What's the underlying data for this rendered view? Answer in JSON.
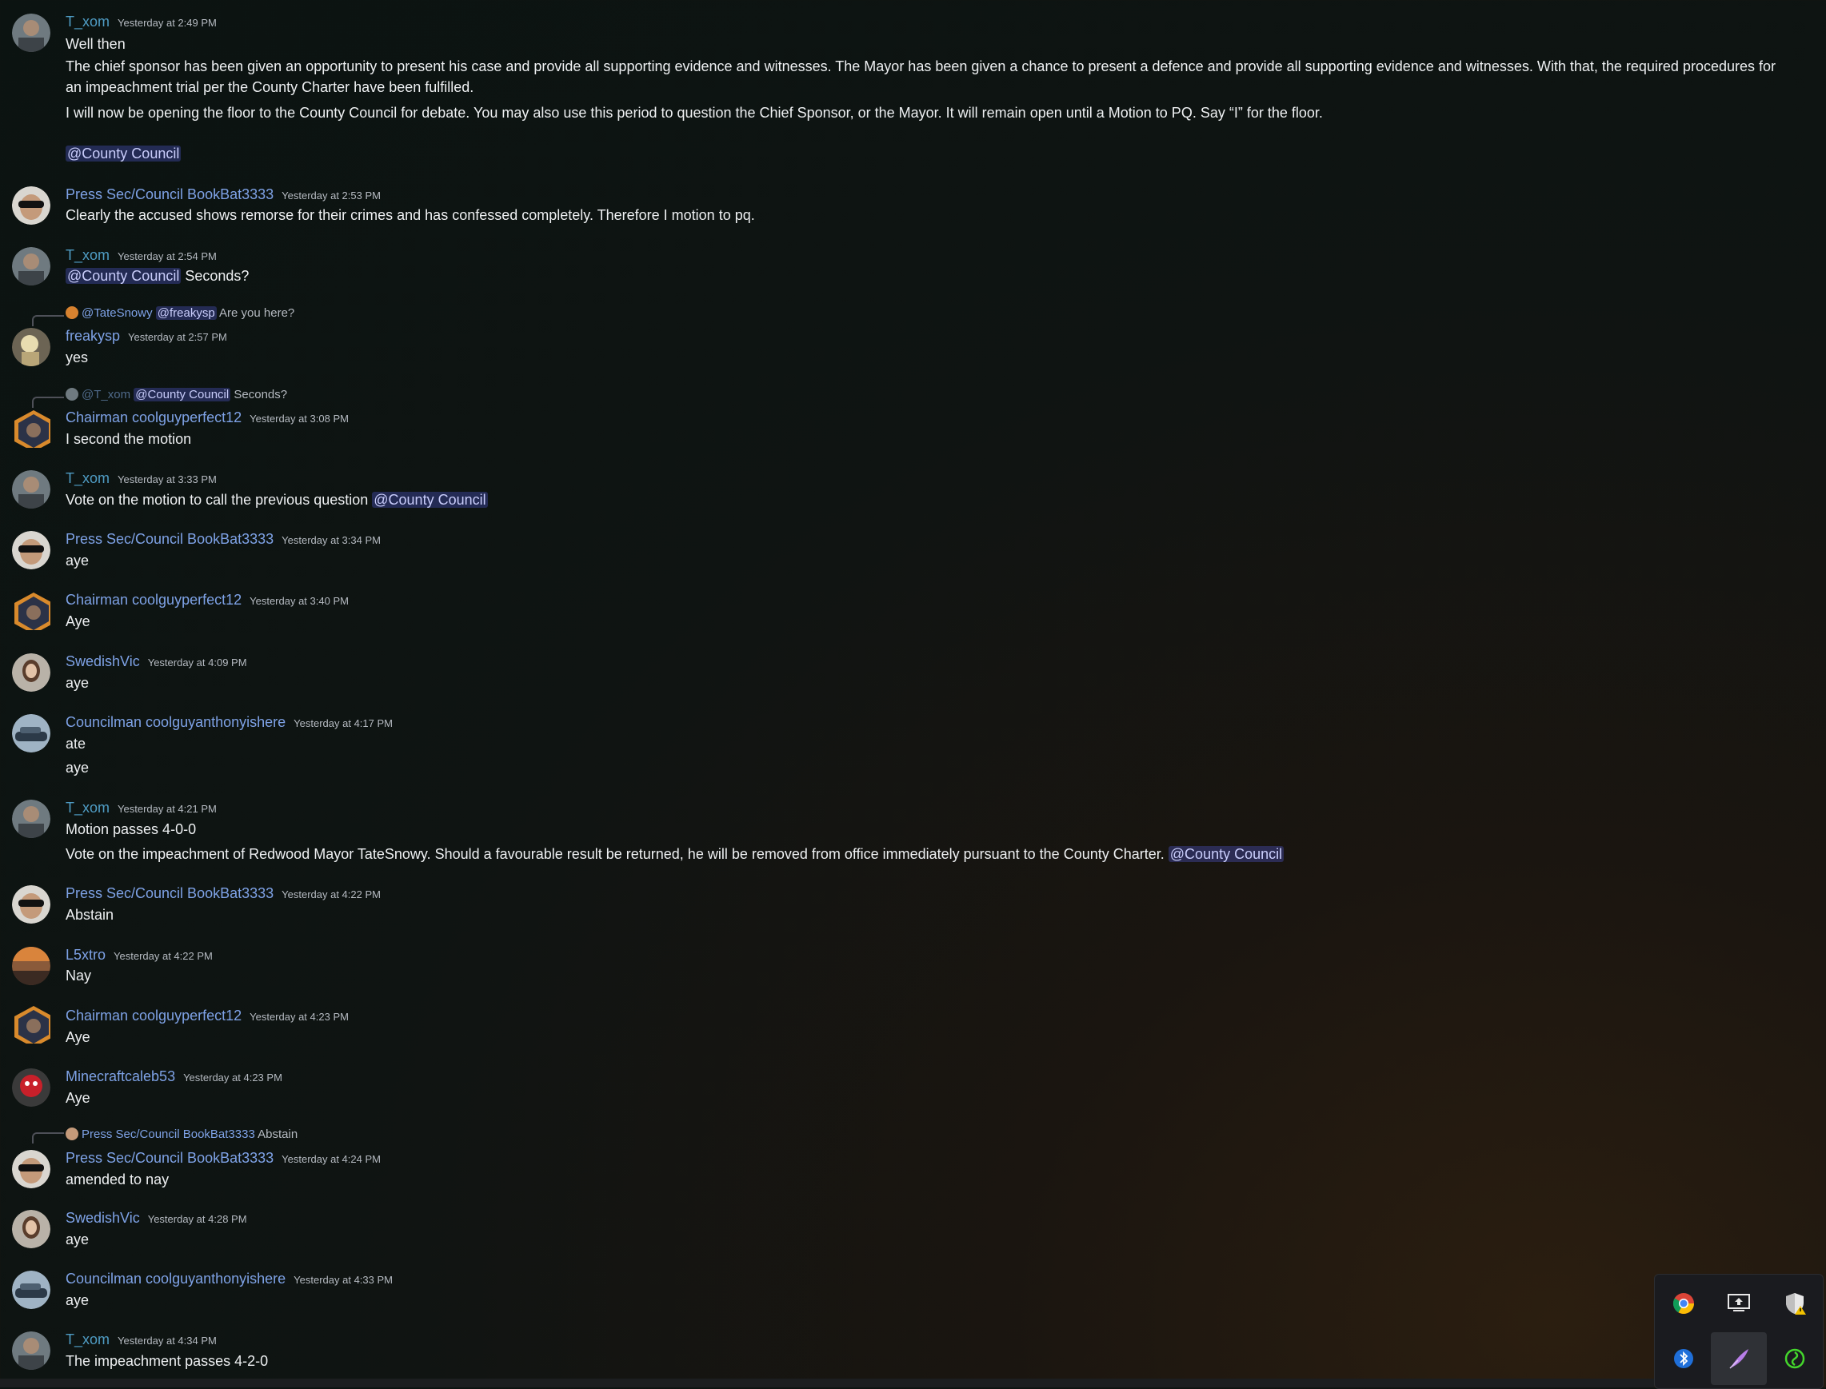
{
  "messages": [
    {
      "author": "T_xom",
      "time": "Yesterday at 2:49 PM",
      "lines": [
        "Well then",
        "The chief sponsor has been given an opportunity to present his case and provide all supporting evidence and witnesses. The Mayor has been given a chance to present a defence and provide all supporting evidence and witnesses. With that, the required procedures for an impeachment trial per the County Charter have been fulfilled.",
        "I will now be opening the floor to the County Council for debate. You may also use this period to question the Chief Sponsor, or the Mayor. It will remain open until a Motion to PQ. Say “I” for the floor.",
        "@County Council"
      ]
    },
    {
      "author": "Press Sec/Council BookBat3333",
      "time": "Yesterday at 2:53 PM",
      "lines": [
        "Clearly the accused shows remorse for their crimes and has confessed completely. Therefore I motion to pq."
      ]
    },
    {
      "author": "T_xom",
      "time": "Yesterday at 2:54 PM",
      "mention": "@County Council",
      "lines": [
        "Seconds?"
      ]
    },
    {
      "reply": {
        "author": "@TateSnowy",
        "mention": "@freakysp",
        "text": "Are you here?"
      },
      "author": "freakysp",
      "time": "Yesterday at 2:57 PM",
      "lines": [
        "yes"
      ]
    },
    {
      "reply": {
        "author": "@T_xom",
        "mention": "@County Council",
        "text": "Seconds?"
      },
      "author": "Chairman coolguyperfect12",
      "time": "Yesterday at 3:08 PM",
      "lines": [
        "I second the motion"
      ]
    },
    {
      "author": "T_xom",
      "time": "Yesterday at 3:33 PM",
      "lines": [
        "Vote on the motion to call the previous question"
      ],
      "mention": "@County Council"
    },
    {
      "author": "Press Sec/Council BookBat3333",
      "time": "Yesterday at 3:34 PM",
      "lines": [
        "aye"
      ]
    },
    {
      "author": "Chairman coolguyperfect12",
      "time": "Yesterday at 3:40 PM",
      "lines": [
        "Aye"
      ]
    },
    {
      "author": "SwedishVic",
      "time": "Yesterday at 4:09 PM",
      "lines": [
        "aye"
      ]
    },
    {
      "author": "Councilman coolguyanthonyishere",
      "time": "Yesterday at 4:17 PM",
      "lines": [
        "ate",
        "aye"
      ]
    },
    {
      "author": "T_xom",
      "time": "Yesterday at 4:21 PM",
      "lines": [
        "Motion passes 4-0-0",
        "Vote on the impeachment of Redwood Mayor TateSnowy. Should a favourable result be returned, he will be removed from office immediately pursuant to the County Charter."
      ],
      "mention": "@County Council"
    },
    {
      "author": "Press Sec/Council BookBat3333",
      "time": "Yesterday at 4:22 PM",
      "lines": [
        "Abstain"
      ]
    },
    {
      "author": "L5xtro",
      "time": "Yesterday at 4:22 PM",
      "lines": [
        "Nay"
      ]
    },
    {
      "author": "Chairman coolguyperfect12",
      "time": "Yesterday at 4:23 PM",
      "lines": [
        "Aye"
      ]
    },
    {
      "author": "Minecraftcaleb53",
      "time": "Yesterday at 4:23 PM",
      "lines": [
        "Aye"
      ]
    },
    {
      "reply": {
        "author": "Press Sec/Council BookBat3333",
        "text": "Abstain"
      },
      "author": "Press Sec/Council BookBat3333",
      "time": "Yesterday at 4:24 PM",
      "lines": [
        "amended to nay"
      ]
    },
    {
      "author": "SwedishVic",
      "time": "Yesterday at 4:28 PM",
      "lines": [
        "aye"
      ]
    },
    {
      "author": "Councilman coolguyanthonyishere",
      "time": "Yesterday at 4:33 PM",
      "lines": [
        "aye"
      ]
    },
    {
      "author": "T_xom",
      "time": "Yesterday at 4:34 PM",
      "lines": [
        "The impeachment passes 4-2-0"
      ]
    }
  ],
  "tray_icons": [
    "chrome-icon",
    "screen-share-icon",
    "security-shield-icon",
    "bluetooth-icon",
    "feather-pen-icon",
    "razer-icon"
  ],
  "colors": {
    "username": "#7ea2e6",
    "username_txom": "#4f9cc4",
    "mention_bg": "#5865f2",
    "background": "#0b1311"
  }
}
